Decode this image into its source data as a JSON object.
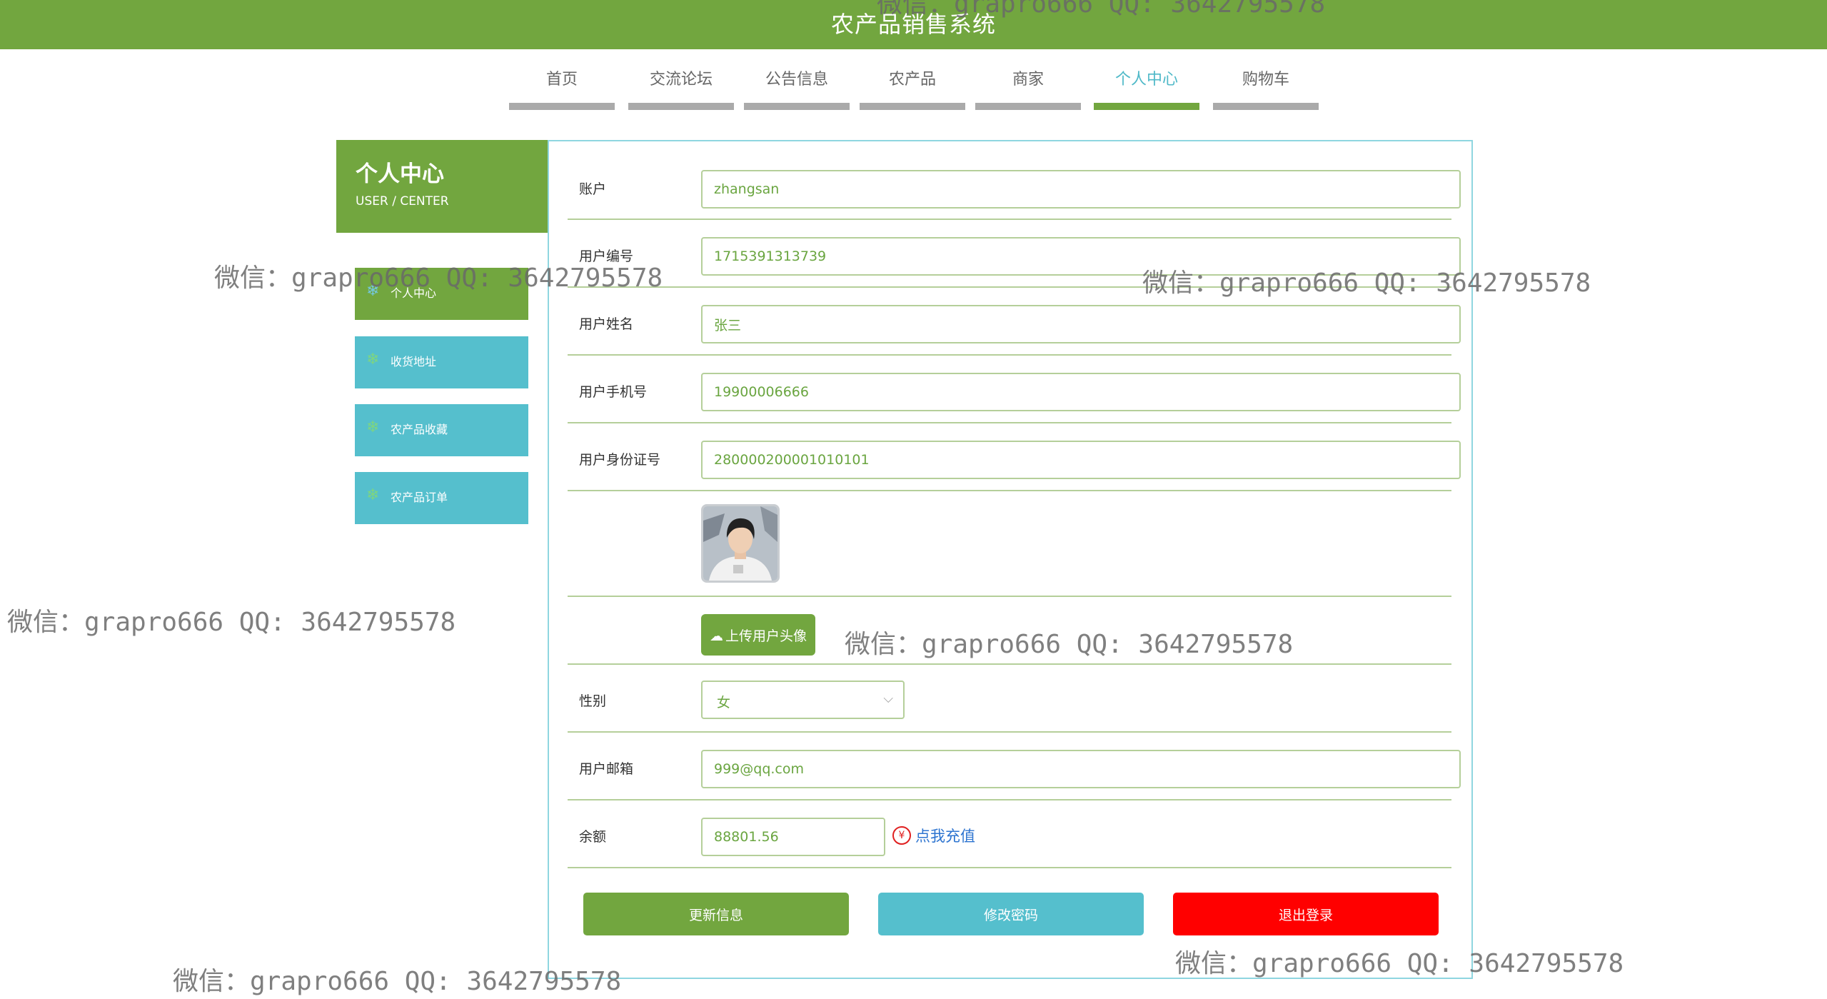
{
  "header": {
    "title": "农产品销售系统"
  },
  "nav": {
    "items": [
      {
        "label": "首页"
      },
      {
        "label": "交流论坛"
      },
      {
        "label": "公告信息"
      },
      {
        "label": "农产品"
      },
      {
        "label": "商家"
      },
      {
        "label": "个人中心",
        "active": true
      },
      {
        "label": "购物车"
      }
    ]
  },
  "sidebar": {
    "title": "个人中心",
    "subtitle": "USER / CENTER",
    "icon": "snowflake-icon",
    "items": [
      {
        "label": "个人中心",
        "active": true
      },
      {
        "label": "收货地址"
      },
      {
        "label": "农产品收藏"
      },
      {
        "label": "农产品订单"
      }
    ]
  },
  "form": {
    "account": {
      "label": "账户",
      "value": "zhangsan"
    },
    "user_no": {
      "label": "用户编号",
      "value": "1715391313739"
    },
    "user_name": {
      "label": "用户姓名",
      "value": "张三"
    },
    "phone": {
      "label": "用户手机号",
      "value": "19900006666"
    },
    "id_card": {
      "label": "用户身份证号",
      "value": "280000200001010101"
    },
    "upload_label": "上传用户头像",
    "gender": {
      "label": "性别",
      "value": "女"
    },
    "email": {
      "label": "用户邮箱",
      "value": "999@qq.com"
    },
    "balance": {
      "label": "余额",
      "value": "88801.56",
      "recharge_label": "点我充值"
    }
  },
  "buttons": {
    "update": "更新信息",
    "change_password": "修改密码",
    "logout": "退出登录"
  },
  "colors": {
    "primary_green": "#72a63f",
    "teal": "#55bfcd",
    "danger": "#ff0000",
    "link": "#2d74d0"
  },
  "watermark": "微信：grapro666 QQ: 3642795578"
}
